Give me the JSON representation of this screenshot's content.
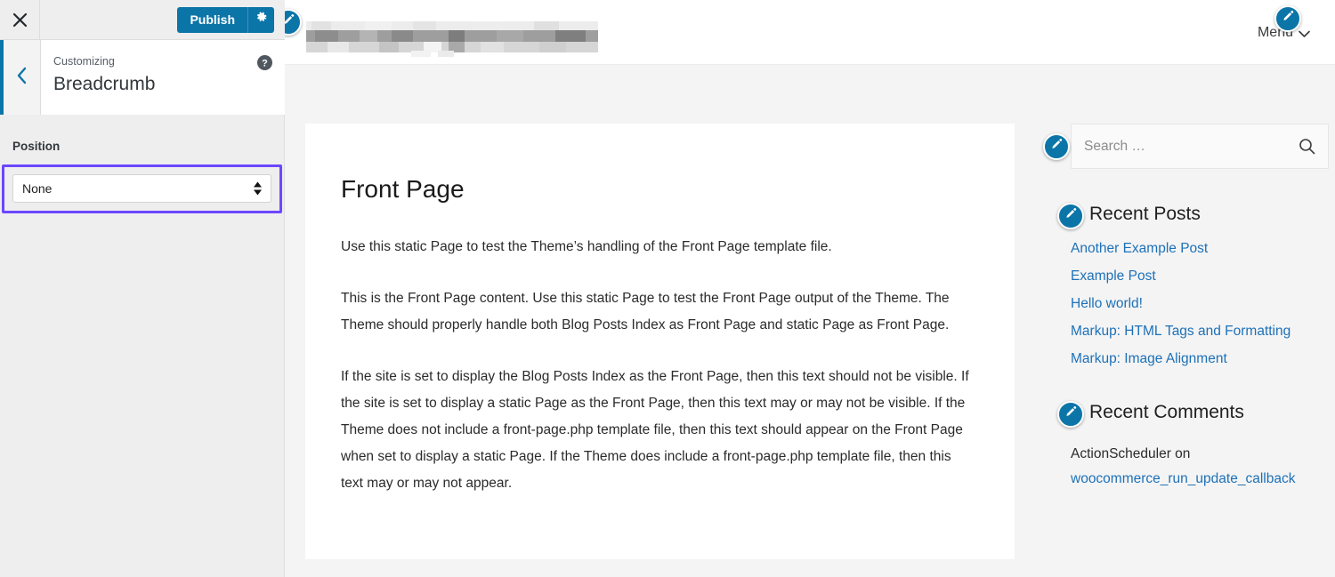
{
  "customizer": {
    "close_label": "Close",
    "close_icon": "close-icon",
    "publish_label": "Publish",
    "gear_icon": "gear-icon",
    "back_icon": "chevron-left-icon",
    "help_icon": "help-circle-icon",
    "breadcrumb_label": "Customizing",
    "panel_title": "Breadcrumb",
    "control": {
      "label": "Position",
      "selected": "None",
      "options": [
        "None"
      ],
      "focus_ring_color": "#6c47ff"
    },
    "accent_color": "#0c75a8"
  },
  "preview": {
    "header": {
      "site_title_obscured": true,
      "menu_label": "Menu",
      "menu_chevron_icon": "chevron-down-icon",
      "edit_icon": "pencil-edit-icon"
    },
    "post": {
      "title": "Front Page",
      "paragraphs": [
        "Use this static Page to test the Theme’s handling of the Front Page template file.",
        "This is the Front Page content. Use this static Page to test the Front Page output of the Theme. The Theme should properly handle both Blog Posts Index as Front Page and static Page as Front Page.",
        "If the site is set to display the Blog Posts Index as the Front Page, then this text should not be visible. If the site is set to display a static Page as the Front Page, then this text may or may not be visible. If the Theme does not include a front-page.php template file, then this text should appear on the Front Page when set to display a static Page. If the Theme does include a front-page.php template file, then this text may or may not appear."
      ]
    },
    "widgets": {
      "search": {
        "placeholder": "Search …",
        "value": "",
        "search_icon": "search-icon",
        "edit_icon": "pencil-edit-icon"
      },
      "recent_posts": {
        "title": "Recent Posts",
        "edit_icon": "pencil-edit-icon",
        "items": [
          "Another Example Post",
          "Example Post",
          "Hello world!",
          "Markup: HTML Tags and Formatting",
          "Markup: Image Alignment"
        ]
      },
      "recent_comments": {
        "title": "Recent Comments",
        "edit_icon": "pencil-edit-icon",
        "items": [
          {
            "author": "ActionScheduler on",
            "link": "woocommerce_run_update_callback"
          }
        ]
      },
      "link_color": "#1d71b8"
    }
  }
}
